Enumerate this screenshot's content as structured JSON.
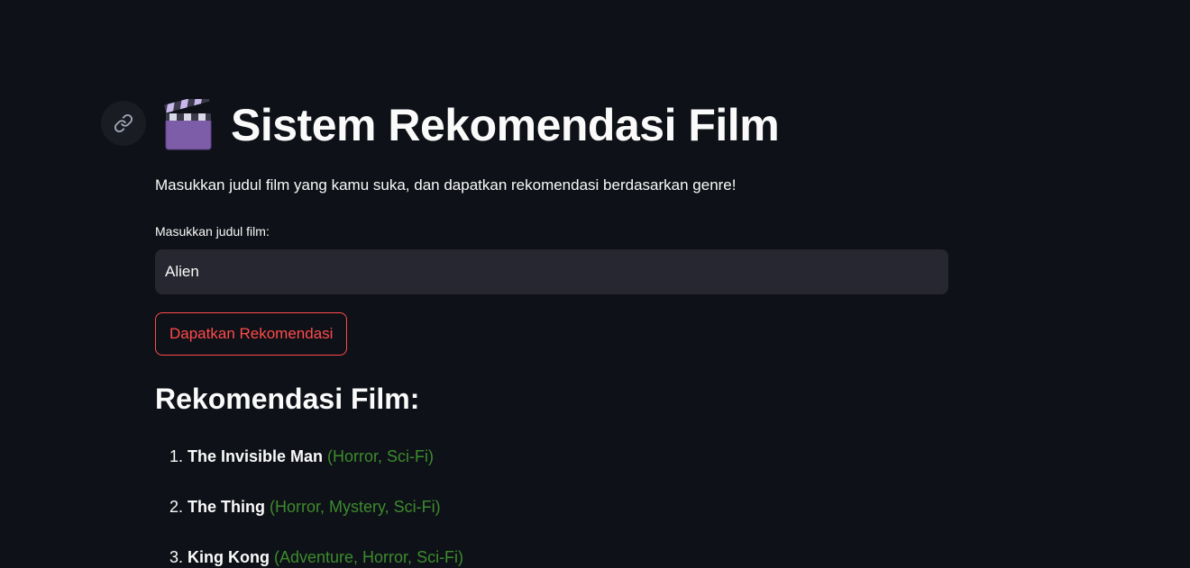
{
  "page": {
    "title": "Sistem Rekomendasi Film",
    "subtitle": "Masukkan judul film yang kamu suka, dan dapatkan rekomendasi berdasarkan genre!"
  },
  "form": {
    "label": "Masukkan judul film:",
    "value": "Alien",
    "button_label": "Dapatkan Rekomendasi"
  },
  "results": {
    "heading": "Rekomendasi Film:",
    "items": [
      {
        "number": "1.",
        "title": "The Invisible Man",
        "genres": "(Horror, Sci-Fi)"
      },
      {
        "number": "2.",
        "title": "The Thing",
        "genres": "(Horror, Mystery, Sci-Fi)"
      },
      {
        "number": "3.",
        "title": "King Kong",
        "genres": "(Adventure, Horror, Sci-Fi)"
      }
    ]
  },
  "icons": {
    "anchor": "link-icon",
    "title": "clapper-board-icon"
  },
  "colors": {
    "background": "#0e1117",
    "input_background": "#262730",
    "accent": "#ff4b4b",
    "genre_text": "#3d8b2e"
  }
}
